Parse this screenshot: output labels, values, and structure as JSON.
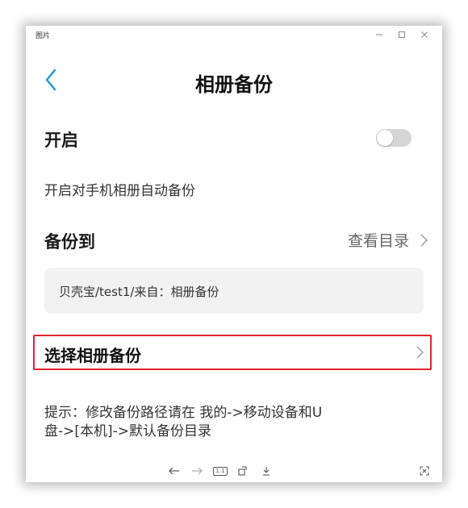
{
  "window": {
    "title": "图片"
  },
  "header": {
    "title": "相册备份"
  },
  "enable": {
    "label": "开启",
    "toggle_on": false,
    "description": "开启对手机相册自动备份"
  },
  "backup_to": {
    "label": "备份到",
    "view_directory": "查看目录",
    "path": "贝壳宝/test1/来自：相册备份"
  },
  "select_album": {
    "label": "选择相册备份",
    "highlight_color": "#e0262f"
  },
  "tip": {
    "line1": "提示：修改备份路径请在 我的->移动设备和U",
    "line2": "盘->[本机]->默认备份目录"
  },
  "viewer_toolbar": {
    "ratio_label": "1:1"
  },
  "colors": {
    "accent": "#2196d3",
    "toggle_off": "#d5d5d5",
    "path_bg": "#f2f2f2"
  }
}
